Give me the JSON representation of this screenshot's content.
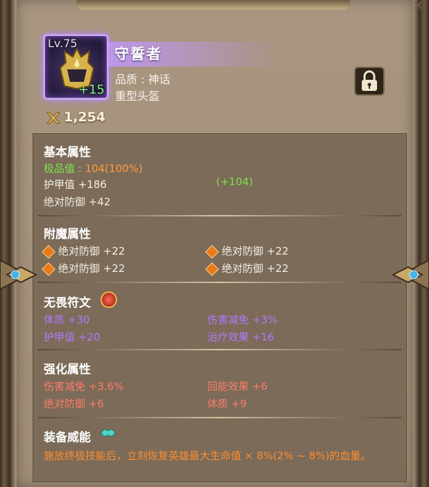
{
  "item": {
    "level": "Lv.75",
    "enhance": "+15",
    "name": "守誓者",
    "quality_label": "品质 : 神话",
    "type_label": "重型头盔",
    "power": "1,254"
  },
  "basic": {
    "title": "基本属性",
    "quality_value_label": "极品值 : ",
    "quality_value": "104(100%)",
    "armor": "护甲值 +186",
    "armor_bonus": "(+104)",
    "abs_def": "绝对防御 +42"
  },
  "enchant": {
    "title": "附魔属性",
    "items": [
      "绝对防御 +22",
      "绝对防御 +22",
      "绝对防御 +22",
      "绝对防御 +22"
    ]
  },
  "rune": {
    "title": "无畏符文",
    "items": [
      "体质 +30",
      "伤害减免 +3%",
      "护甲值 +20",
      "治疗效果 +16"
    ]
  },
  "enhance": {
    "title": "强化属性",
    "items": [
      "伤害减免 +3.6%",
      "回能效果 +6",
      "绝对防御 +6",
      "体质 +9"
    ]
  },
  "majesty": {
    "title": "装备威能",
    "text": "施放终极技能后，立刻恢复英雄最大生命值 × 8%(2% ~ 8%)的血量。"
  },
  "icons": [
    "helmet-icon",
    "lock-icon",
    "power-icon",
    "diamond-icon",
    "rune-icon",
    "majesty-icon",
    "close-icon"
  ]
}
